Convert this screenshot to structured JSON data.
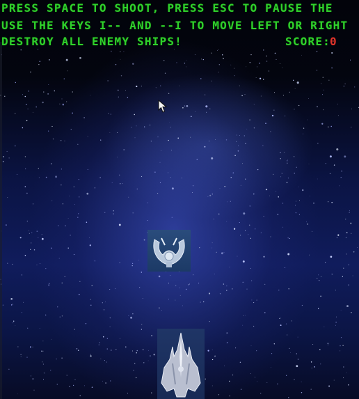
{
  "hud": {
    "line1": "PRESS SPACE TO SHOOT, PRESS ESC TO PAUSE THE",
    "line2": "USE THE KEYS I-- AND --I TO MOVE LEFT OR RIGHT",
    "line3": "DESTROY ALL ENEMY SHIPS!",
    "score_label": "SCORE:",
    "score_value": "0"
  },
  "colors": {
    "hud_text": "#2fd12b",
    "score_value": "#e0342a",
    "space_background": "#0b1444"
  },
  "sprites": {
    "enemy": "enemy-ship-icon",
    "player": "player-ship-icon",
    "cursor": "mouse-pointer-icon"
  }
}
